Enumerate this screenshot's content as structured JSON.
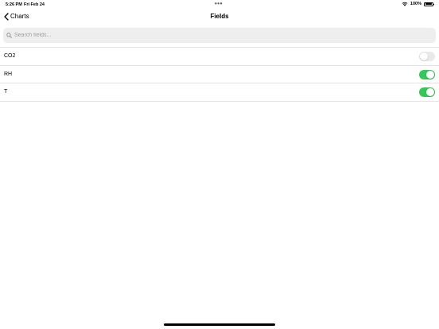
{
  "status_bar": {
    "time": "5:26 PM",
    "date": "Fri Feb 24",
    "multitask_dots": "•••",
    "battery": "100%"
  },
  "nav": {
    "back_label": "Charts",
    "title": "Fields"
  },
  "search": {
    "value": "",
    "placeholder": "Search fields..."
  },
  "fields": [
    {
      "label": "CO2",
      "enabled": false
    },
    {
      "label": "RH",
      "enabled": true
    },
    {
      "label": "T",
      "enabled": true
    }
  ],
  "colors": {
    "toggle_on": "#34c759",
    "toggle_off": "#e9e9eb",
    "search_bg": "#eeeeef"
  },
  "icons": {
    "back": "chevron-left-icon",
    "search": "magnifying-glass-icon",
    "wifi": "wifi-icon",
    "battery": "battery-icon"
  }
}
